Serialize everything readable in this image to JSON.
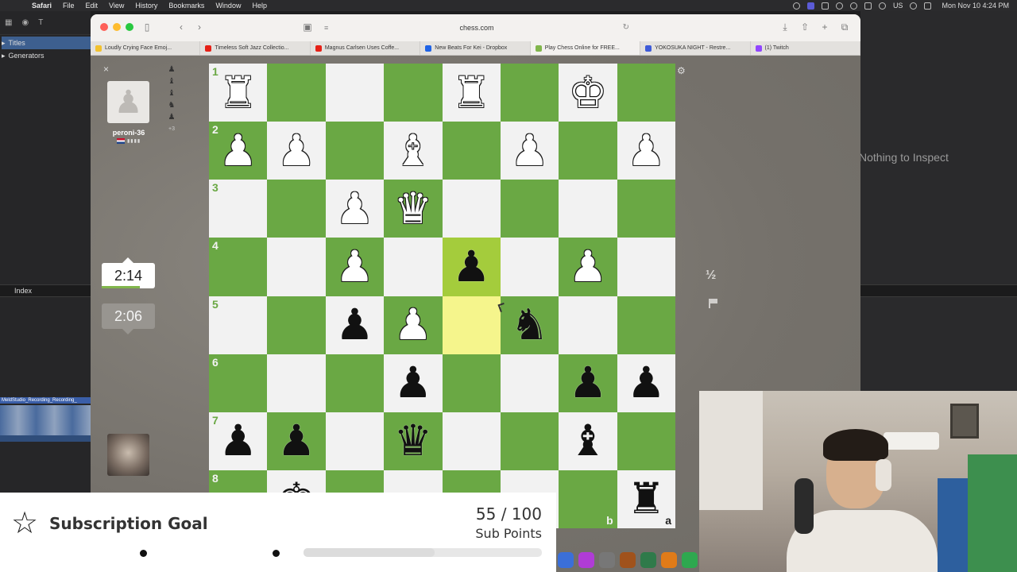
{
  "menubar": {
    "app_name": "Safari",
    "items": [
      "File",
      "Edit",
      "View",
      "History",
      "Bookmarks",
      "Window",
      "Help"
    ],
    "status": {
      "keyboard": "US",
      "clock": "Mon Nov 10  4:24 PM"
    }
  },
  "editor": {
    "left_tree": [
      {
        "label": "Titles",
        "selected": true
      },
      {
        "label": "Generators",
        "selected": false
      }
    ],
    "index_label": "Index",
    "clip_name": "MeldStudio_Recording_Recording_",
    "inspector_text": "Nothing to Inspect"
  },
  "browser": {
    "address": "chess.com",
    "tabs": [
      {
        "label": "Loudly Crying Face Emoj...",
        "favicon": "emoji",
        "color": "#f2c12e"
      },
      {
        "label": "Timeless Soft Jazz Collectio...",
        "favicon": "youtube",
        "color": "#e62117"
      },
      {
        "label": "Magnus Carlsen Uses Coffe...",
        "favicon": "youtube",
        "color": "#e62117"
      },
      {
        "label": "New Beats For Kei - Dropbox",
        "favicon": "dropbox",
        "color": "#1f63e6"
      },
      {
        "label": "Play Chess Online for FREE...",
        "favicon": "chess-pawn",
        "color": "#81b64c",
        "active": true
      },
      {
        "label": "YOKOSUKA NIGHT - Restre...",
        "favicon": "restream",
        "color": "#3e5bd8"
      },
      {
        "label": "(1) Twitch",
        "favicon": "twitch",
        "color": "#9146ff"
      }
    ]
  },
  "game": {
    "opponent": {
      "name": "peroni-36",
      "flag": "netherlands",
      "captured_more": "+3"
    },
    "clocks": {
      "top": "2:14",
      "bottom": "2:06",
      "top_time_fraction": 0.72
    },
    "board": {
      "orientation": "black",
      "ranks": [
        "1",
        "2",
        "3",
        "4",
        "5",
        "6",
        "7",
        "8"
      ],
      "files_visible": [
        "b",
        "a"
      ],
      "rows": [
        [
          "wR",
          "",
          "",
          "",
          "wR",
          "",
          "wK",
          ""
        ],
        [
          "wP",
          "wP",
          "",
          "wB",
          "",
          "wP",
          "",
          "wP"
        ],
        [
          "",
          "",
          "wP",
          "wQ",
          "",
          "",
          "",
          ""
        ],
        [
          "",
          "",
          "wP",
          "",
          "bP",
          "",
          "wP",
          ""
        ],
        [
          "",
          "",
          "bP",
          "wP",
          "",
          "bN",
          "",
          ""
        ],
        [
          "",
          "",
          "",
          "bP",
          "",
          "",
          "bP",
          "bP"
        ],
        [
          "bP",
          "bP",
          "",
          "bQ",
          "",
          "",
          "bB",
          ""
        ],
        [
          "",
          "bK",
          "",
          "",
          "",
          "",
          "",
          "bR"
        ]
      ],
      "highlights": [
        [
          3,
          4
        ],
        [
          4,
          4
        ]
      ]
    },
    "draw_label": "½"
  },
  "subscription_goal": {
    "title": "Subscription Goal",
    "current": "55",
    "target": "100",
    "count_text": "55 / 100",
    "unit": "Sub Points",
    "progress": 0.55
  },
  "dock": {
    "icon_colors": [
      "#3b6fd8",
      "#b03cd6",
      "#777",
      "#a0521c",
      "#2f7a4a",
      "#e07b18",
      "#2ea84f"
    ]
  }
}
